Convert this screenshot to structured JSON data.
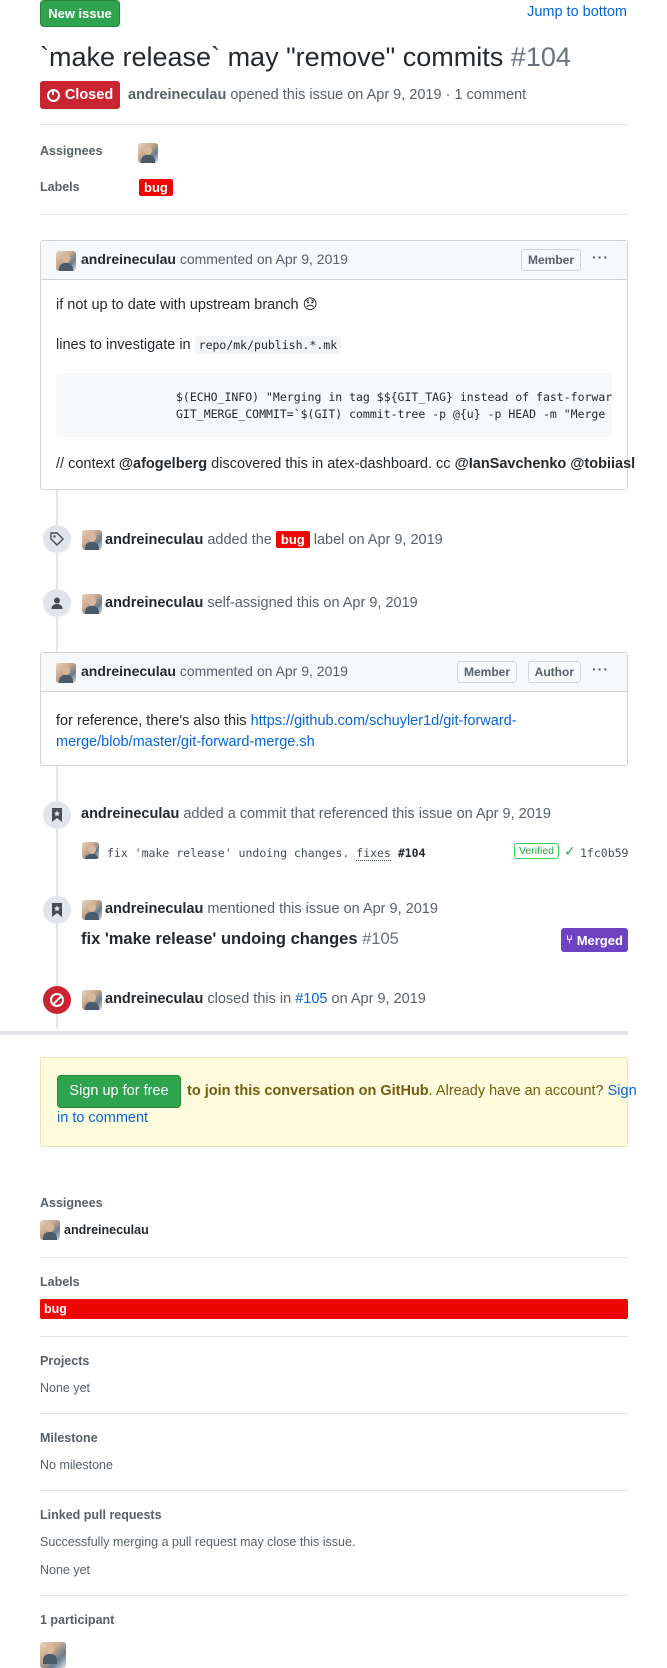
{
  "top": {
    "new_issue": "New issue",
    "jump_to_bottom": "Jump to bottom"
  },
  "issue": {
    "title": "`make release` may \"remove\" commits",
    "number": "#104",
    "state": "Closed",
    "author": "andreineculau",
    "meta": "opened this issue on Apr 9, 2019 · 1 comment"
  },
  "header_sidebar": {
    "assignees_label": "Assignees",
    "labels_label": "Labels",
    "label_name": "bug"
  },
  "comment1": {
    "author": "andreineculau",
    "action": "commented",
    "date": "on Apr 9, 2019",
    "role": "Member",
    "line1": "if not up to date with upstream branch",
    "emoji": "😞",
    "line2_prefix": "lines to investigate in",
    "line2_code": "repo/mk/publish.*.mk",
    "code_line1": "$(ECHO_INFO) \"Merging in tag $${GIT_TAG} instead of fast-forwarding",
    "code_line2": "GIT_MERGE_COMMIT=`$(GIT) commit-tree -p @{u} -p HEAD -m \"Merge tag",
    "ctx_prefix": "// context",
    "ctx_user1": "@afogelberg",
    "ctx_mid": "discovered this in atex-dashboard. cc",
    "ctx_user2": "@IanSavchenko",
    "ctx_user3": "@tobiiasl"
  },
  "event_label": {
    "author": "andreineculau",
    "text1": "added the",
    "label": "bug",
    "text2": "label",
    "date": "on Apr 9, 2019"
  },
  "event_assign": {
    "author": "andreineculau",
    "text": "self-assigned this",
    "date": "on Apr 9, 2019"
  },
  "comment2": {
    "author": "andreineculau",
    "action": "commented",
    "date": "on Apr 9, 2019",
    "role1": "Member",
    "role2": "Author",
    "body_prefix": "for reference, there's also this",
    "link_line1": "https://github.com/schuyler1d/git-forward-",
    "link_line2": "merge/blob/master/git-forward-merge.sh"
  },
  "event_commit": {
    "author": "andreineculau",
    "text": "added a commit that referenced this issue",
    "date": "on Apr 9, 2019",
    "commit_msg": "fix 'make release' undoing changes.",
    "commit_fixes": "fixes",
    "commit_ref": "#104",
    "verified": "Verified",
    "sha": "1fc0b59"
  },
  "event_mention": {
    "author": "andreineculau",
    "text": "mentioned this issue",
    "date": "on Apr 9, 2019",
    "pr_title": "fix 'make release' undoing changes",
    "pr_number": "#105",
    "pr_state": "Merged"
  },
  "event_closed": {
    "author": "andreineculau",
    "text": "closed this in",
    "ref": "#105",
    "date": "on Apr 9, 2019"
  },
  "signup": {
    "button": "Sign up for free",
    "text_bold": "to join this conversation on GitHub",
    "text_rest": ". Already have an account?",
    "link_line1": "Sign",
    "link_line2": "in to comment"
  },
  "sidebar": {
    "assignees_label": "Assignees",
    "assignee": "andreineculau",
    "labels_label": "Labels",
    "label": "bug",
    "projects_label": "Projects",
    "projects_value": "None yet",
    "milestone_label": "Milestone",
    "milestone_value": "No milestone",
    "linked_label": "Linked pull requests",
    "linked_desc": "Successfully merging a pull request may close this issue.",
    "linked_value": "None yet",
    "participants_label": "1 participant"
  },
  "colors": {
    "green": "#2ea44f",
    "red": "#cb2431",
    "label_bug": "#ee0701",
    "merged": "#6f42c1",
    "link": "#0366d6"
  }
}
